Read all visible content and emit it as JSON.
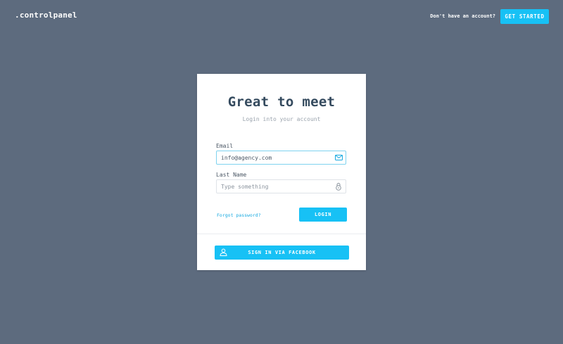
{
  "header": {
    "logo": ".controlpanel",
    "signup_prompt": "Don't have an account?",
    "get_started_label": "GET STARTED"
  },
  "login_card": {
    "title": "Great to meet",
    "subtitle": "Login into your account",
    "email": {
      "label": "Email",
      "value": "info@agency.com",
      "icon": "envelope-icon"
    },
    "last_name": {
      "label": "Last Name",
      "placeholder": "Type something",
      "icon": "lock-icon"
    },
    "forgot_password": "Forgot password?",
    "login_label": "LOGIN",
    "facebook_label": "SIGN IN VIA FACEBOOK",
    "facebook_icon": "user-icon"
  },
  "colors": {
    "background": "#5d6b7e",
    "accent": "#17c1f5",
    "title": "#344a5e",
    "link": "#17a9e0"
  }
}
